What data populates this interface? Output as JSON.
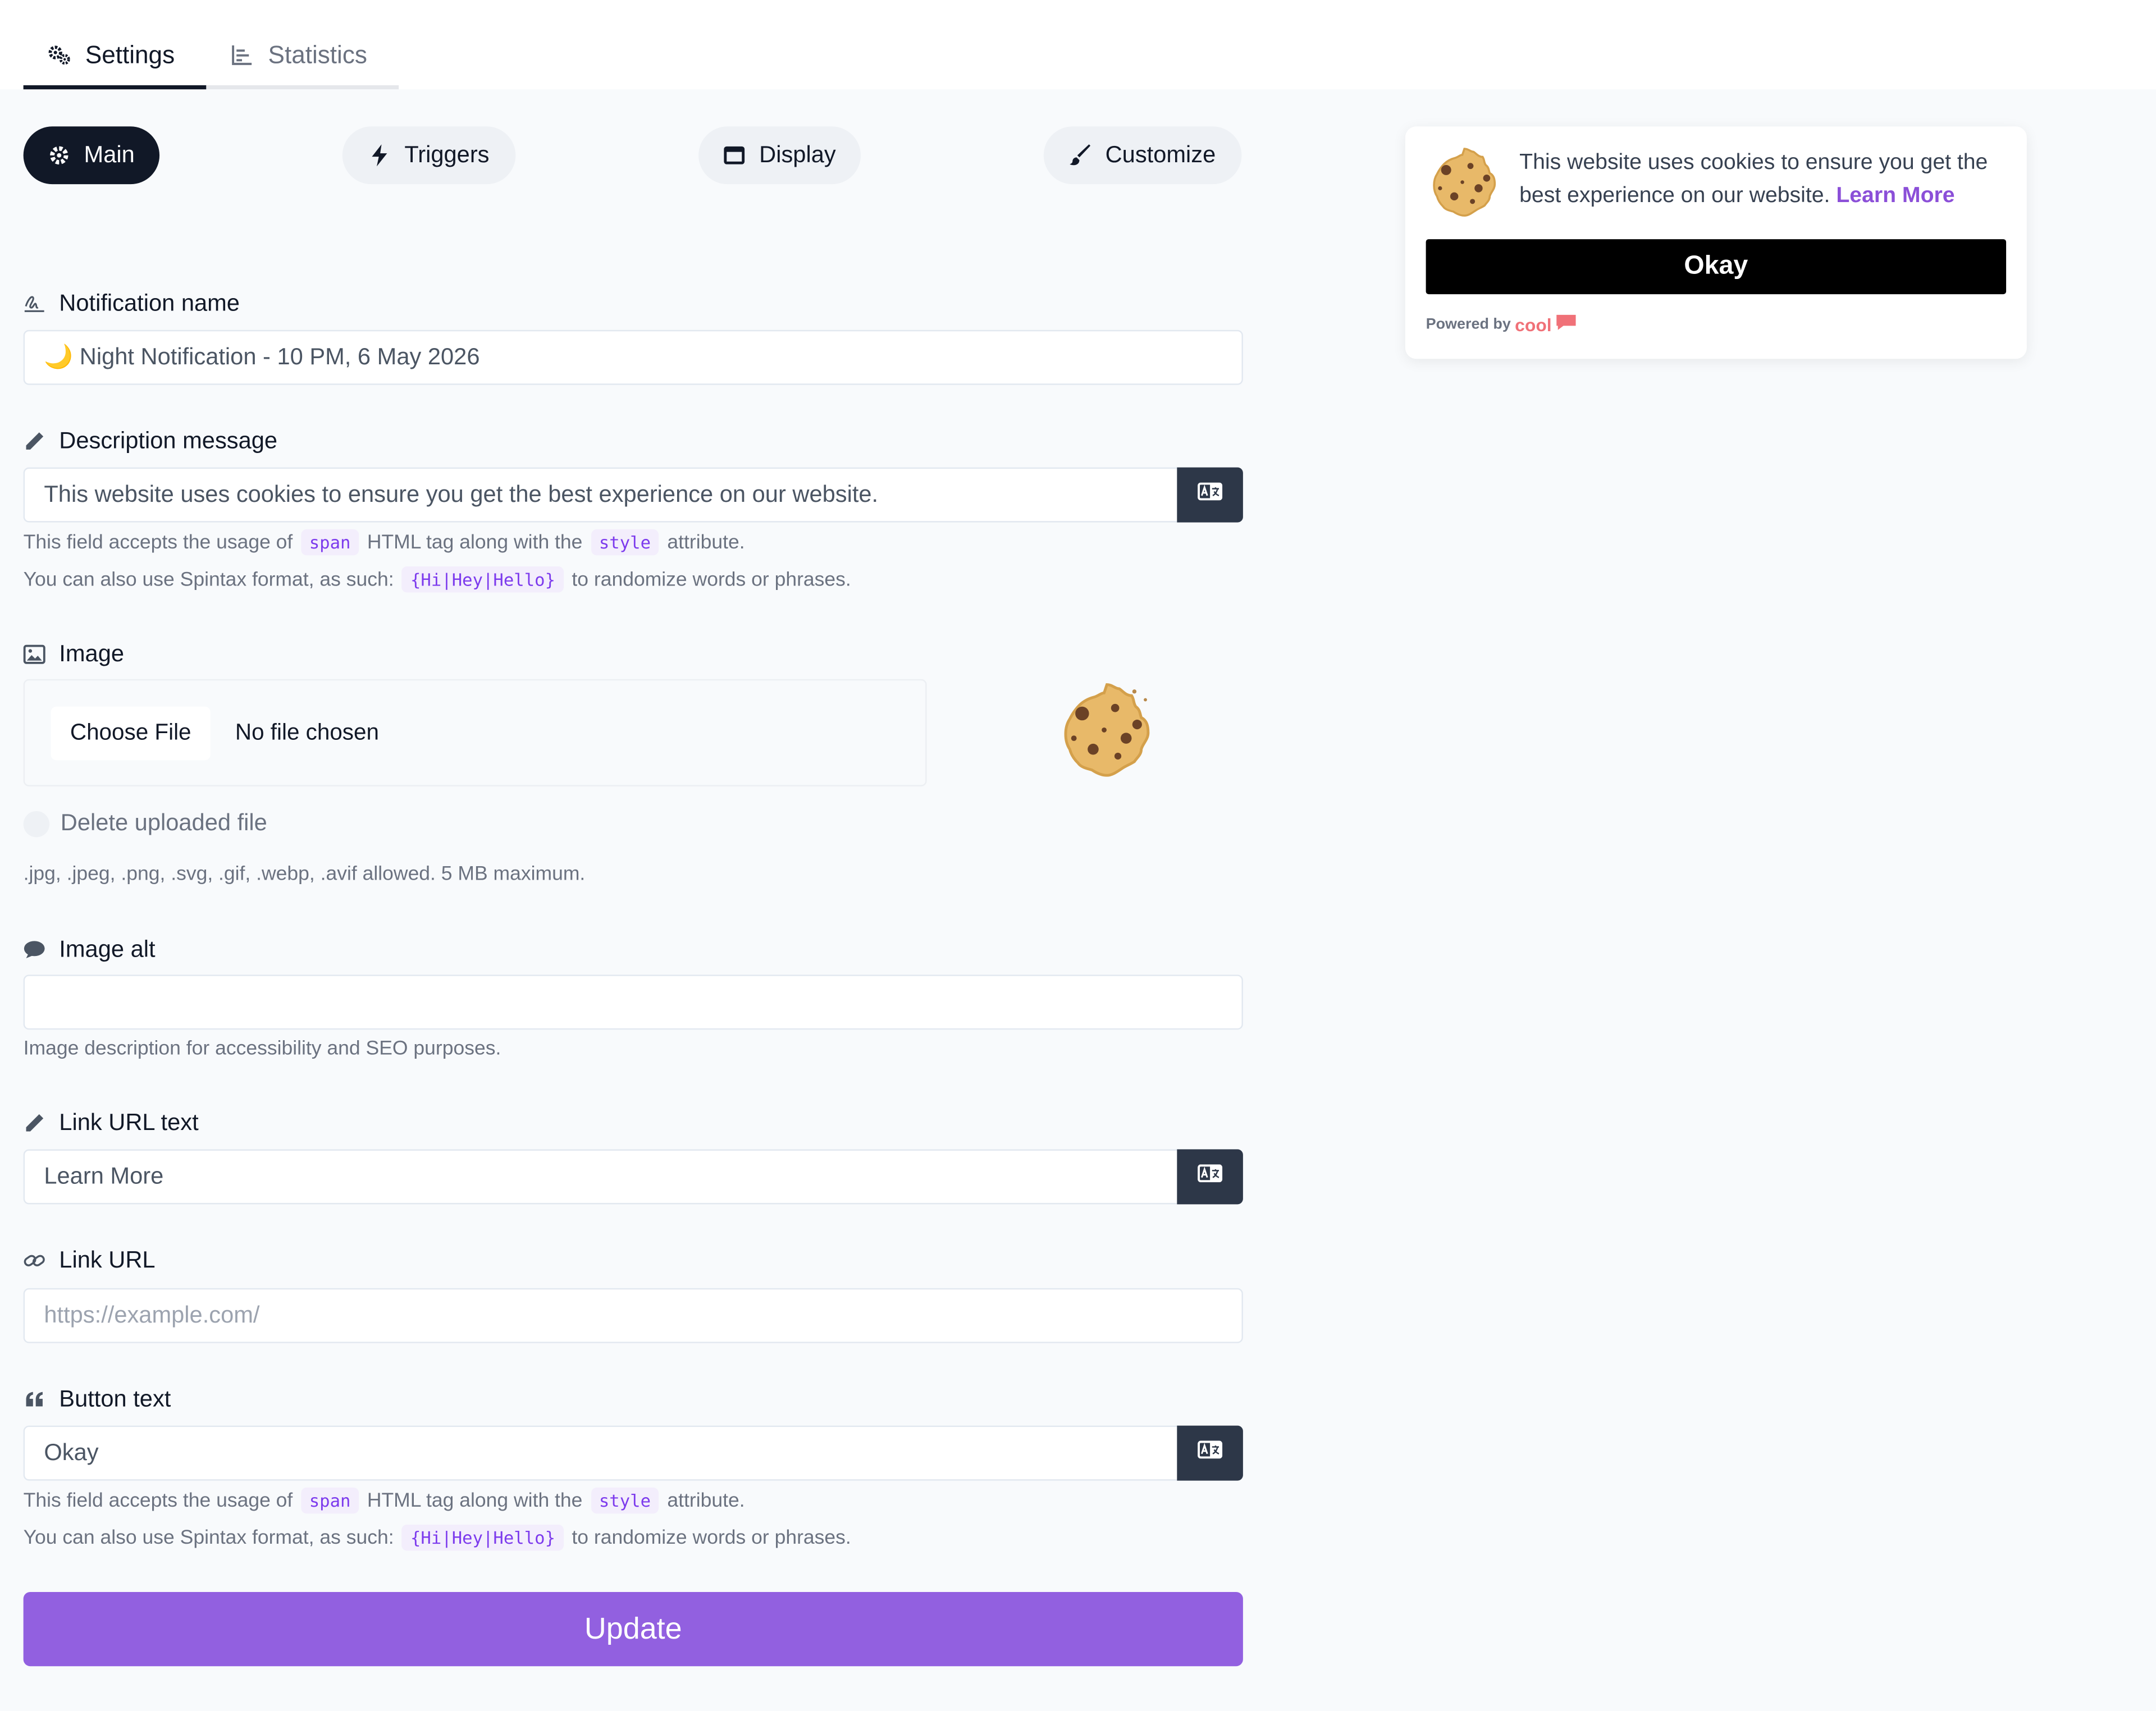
{
  "tabs": [
    {
      "label": "Settings",
      "icon": "gears-icon"
    },
    {
      "label": "Statistics",
      "icon": "bar-chart-icon"
    }
  ],
  "sections": [
    {
      "label": "Main",
      "icon": "gear-icon"
    },
    {
      "label": "Triggers",
      "icon": "bolt-icon"
    },
    {
      "label": "Display",
      "icon": "window-icon"
    },
    {
      "label": "Customize",
      "icon": "brush-icon"
    }
  ],
  "form": {
    "notification_name": {
      "label": "Notification name",
      "value": "🌙 Night Notification - 10 PM, 6 May 2026"
    },
    "description": {
      "label": "Description message",
      "value": "This website uses cookies to ensure you get the best experience on our website."
    },
    "help_span": {
      "part1": "This field accepts the usage of",
      "code1": "span",
      "part2": "HTML tag along with the",
      "code2": "style",
      "part3": "attribute."
    },
    "help_spintax": {
      "part1": "You can also use Spintax format, as such:",
      "code": "{Hi|Hey|Hello}",
      "part2": "to randomize words or phrases."
    },
    "image": {
      "label": "Image",
      "choose_label": "Choose File",
      "file_status": "No file chosen",
      "delete_label": "Delete uploaded file",
      "help": ".jpg, .jpeg, .png, .svg, .gif, .webp, .avif allowed. 5 MB maximum."
    },
    "image_alt": {
      "label": "Image alt",
      "value": "",
      "help": "Image description for accessibility and SEO purposes."
    },
    "link_text": {
      "label": "Link URL text",
      "value": "Learn More"
    },
    "link_url": {
      "label": "Link URL",
      "placeholder": "https://example.com/"
    },
    "button_text": {
      "label": "Button text",
      "value": "Okay"
    },
    "update_label": "Update"
  },
  "preview": {
    "message": "This website uses cookies to ensure you get the best experience on our website.",
    "link_text": "Learn More",
    "button": "Okay",
    "powered_prefix": "Powered by",
    "powered_brand": "cool"
  },
  "colors": {
    "accent": "#9260e0",
    "link": "#8b4fd8",
    "dark": "#111827",
    "addon": "#2d3748"
  }
}
